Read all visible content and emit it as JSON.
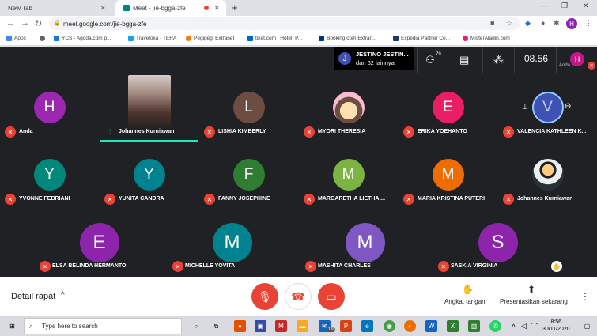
{
  "browser": {
    "tabs": [
      {
        "label": "New Tab",
        "close": "✕"
      },
      {
        "label": "Meet - jie-bgga-zfe",
        "close": "✕"
      }
    ],
    "new_tab": "+",
    "url": "meet.google.com/jie-bgga-zfe",
    "profile_initial": "H",
    "bookmarks": [
      {
        "label": "Apps",
        "color": "#4285f4"
      },
      {
        "label": "YCS - Agoda.com p...",
        "color": "#1a73e8"
      },
      {
        "label": "Traveloka - TERA",
        "color": "#1ba0e2"
      },
      {
        "label": "Pegipegi Extranet",
        "color": "#f57c00"
      },
      {
        "label": "tiket.com | Hotel, P...",
        "color": "#0064d2"
      },
      {
        "label": "Booking.com Extran...",
        "color": "#003580"
      },
      {
        "label": "Expedia Partner Ce...",
        "color": "#1b3a6b"
      },
      {
        "label": "MisterAladin.com",
        "color": "#e91e63"
      }
    ]
  },
  "header": {
    "presenter_initial": "J",
    "presenter_name": "JESTINO JESTIN...",
    "presenter_sub": "dan 62 lainnya",
    "people_count": "79",
    "time": "08.56",
    "self_initial": "H",
    "self_label": "Anda"
  },
  "participants": [
    {
      "name": "Anda",
      "initial": "H",
      "color": "#9c27b0",
      "kind": "letter"
    },
    {
      "name": "Johannes Kurniawan",
      "initial": "",
      "color": "#000000",
      "kind": "video"
    },
    {
      "name": "LISHIA KIMBERLY",
      "initial": "L",
      "color": "#6d4c41",
      "kind": "letter"
    },
    {
      "name": "MYORI THERESIA",
      "initial": "",
      "color": "#f8bbd0",
      "kind": "cartoon"
    },
    {
      "name": "ERIKA YOEHANTO",
      "initial": "E",
      "color": "#e91e63",
      "kind": "letter"
    },
    {
      "name": "VALENCIA KATHLEEN K...",
      "initial": "V",
      "color": "#3f51b5",
      "kind": "logo"
    },
    {
      "name": "YVONNE FEBRIANI",
      "initial": "Y",
      "color": "#00897b",
      "kind": "letter"
    },
    {
      "name": "YUNITA CANDRA",
      "initial": "Y",
      "color": "#00838f",
      "kind": "letter"
    },
    {
      "name": "FANNY JOSEPHINE",
      "initial": "F",
      "color": "#2e7d32",
      "kind": "letter"
    },
    {
      "name": "MARGARETHA LIETHA ...",
      "initial": "M",
      "color": "#7cb342",
      "kind": "letter"
    },
    {
      "name": "MARIA KRISTINA PUTERI",
      "initial": "M",
      "color": "#ef6c00",
      "kind": "letter"
    },
    {
      "name": "Johannes Kurniawan",
      "initial": "",
      "color": "#eceff1",
      "kind": "photo"
    },
    {
      "name": "ELSA BELINDA HERMANTO",
      "initial": "E",
      "color": "#8e24aa",
      "kind": "letter"
    },
    {
      "name": "MICHELLE YOVITA",
      "initial": "M",
      "color": "#00838f",
      "kind": "letter"
    },
    {
      "name": "MASHITA CHARLES",
      "initial": "M",
      "color": "#7e57c2",
      "kind": "letter"
    },
    {
      "name": "SASKIA VIRGINIA",
      "initial": "S",
      "color": "#8e24aa",
      "kind": "letter"
    }
  ],
  "bottom": {
    "detail_label": "Detail rapat",
    "raise_hand": "Angkat tangan",
    "present_now": "Presentasikan sekarang"
  },
  "taskbar": {
    "search_placeholder": "Type here to search",
    "time": "8:56",
    "date": "30/11/2020",
    "badge_count": "19"
  },
  "colors": {
    "accent_red": "#ea4335",
    "tile_bg": "#3c4043",
    "meet_bg": "#202124",
    "speaking_bar": "#1de9b6"
  }
}
